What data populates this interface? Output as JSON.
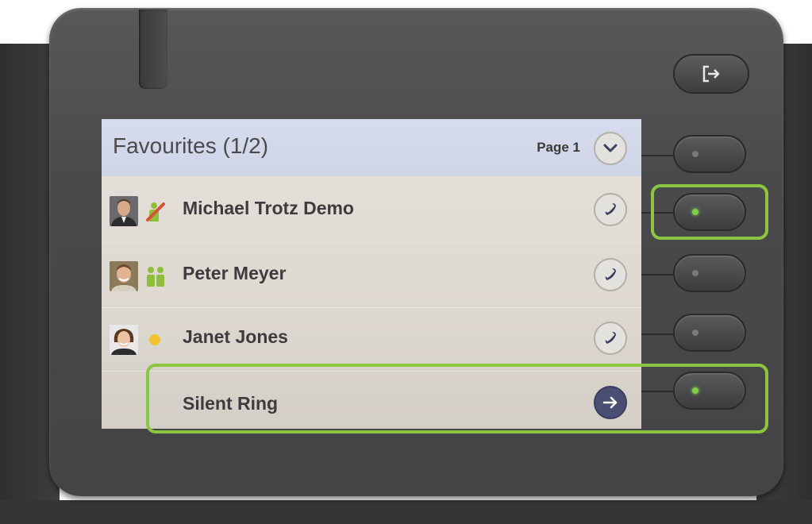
{
  "screen": {
    "title": "Favourites (1/2)",
    "page_label": "Page 1",
    "contacts": [
      {
        "name": "Michael Trotz Demo",
        "status_icon": "busy-presence-icon"
      },
      {
        "name": "Peter Meyer",
        "status_icon": "available-presence-icon"
      },
      {
        "name": "Janet Jones",
        "status_icon": "away-presence-icon"
      }
    ],
    "silent_ring": {
      "label": "Silent Ring"
    }
  },
  "hardware": {
    "logout_icon": "logout-icon",
    "leds": [
      false,
      true,
      false,
      false,
      true
    ]
  },
  "colors": {
    "highlight": "#8cc63f",
    "led_on": "#7ed04a",
    "header_bg": "#d6dced",
    "silent_ring_button": "#4a4e72"
  }
}
